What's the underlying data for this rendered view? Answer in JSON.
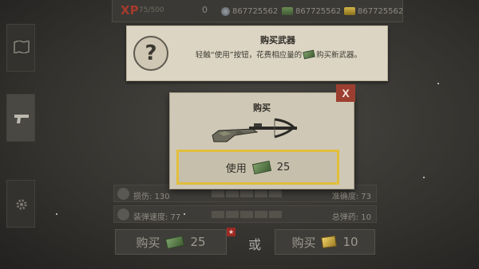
{
  "topbar": {
    "xp_label": "XP",
    "xp_progress": "75/500",
    "xp_level": "0",
    "silver": "867725562",
    "cash": "867725562",
    "gold": "867725562"
  },
  "tooltip": {
    "icon": "?",
    "title": "购买武器",
    "body_before": "轻触“使用”按钮，花费相应量的",
    "body_after": "购买新武器。",
    "body_icon": "cash-icon"
  },
  "dialog": {
    "title": "购买",
    "close_label": "X",
    "use_label": "使用",
    "use_cost": "25"
  },
  "stats": [
    {
      "label": "损伤: 130",
      "right": "准确度: 73",
      "icon": "skull-icon"
    },
    {
      "label": "装弹速度: 77",
      "right": "总弹药: 10",
      "icon": "reload-icon"
    }
  ],
  "buy_bar": {
    "buy_cash_label": "购买",
    "buy_cash_cost": "25",
    "or_label": "或",
    "buy_gold_label": "购买",
    "buy_gold_cost": "10"
  },
  "colors": {
    "accent_gold": "#e2be3a",
    "close_red": "#9c3f30",
    "xp_red": "#a43a2b"
  }
}
